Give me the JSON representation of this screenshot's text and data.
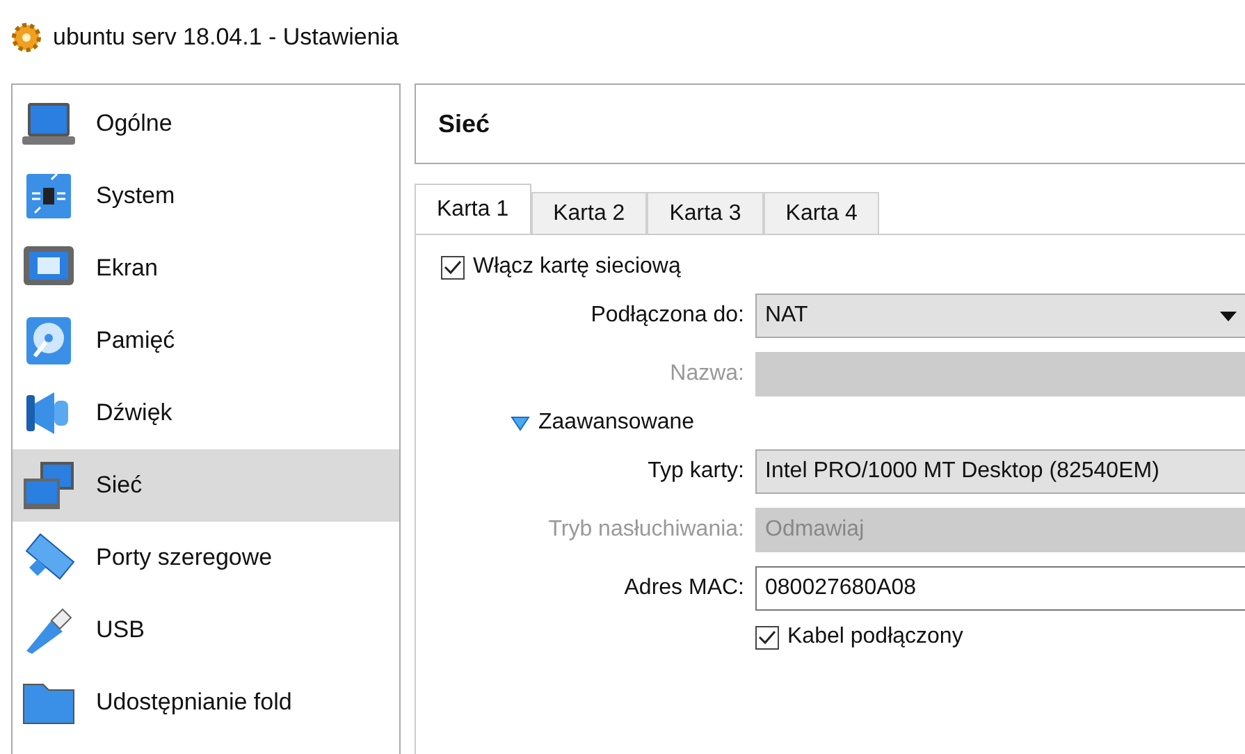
{
  "window": {
    "title": "ubuntu serv 18.04.1 - Ustawienia"
  },
  "sidebar": {
    "items": [
      {
        "label": "Ogólne",
        "selected": false
      },
      {
        "label": "System",
        "selected": false
      },
      {
        "label": "Ekran",
        "selected": false
      },
      {
        "label": "Pamięć",
        "selected": false
      },
      {
        "label": "Dźwięk",
        "selected": false
      },
      {
        "label": "Sieć",
        "selected": true
      },
      {
        "label": "Porty szeregowe",
        "selected": false
      },
      {
        "label": "USB",
        "selected": false
      },
      {
        "label": "Udostępnianie fold",
        "selected": false
      }
    ]
  },
  "page": {
    "title": "Sieć"
  },
  "tabs": [
    {
      "label": "Karta 1",
      "selected": true
    },
    {
      "label": "Karta 2",
      "selected": false
    },
    {
      "label": "Karta 3",
      "selected": false
    },
    {
      "label": "Karta 4",
      "selected": false
    }
  ],
  "enable_adapter": {
    "label": "Włącz kartę sieciową",
    "checked": true
  },
  "fields_top": [
    {
      "kind": "dropdown",
      "label": "Podłączona do:",
      "value": "NAT",
      "disabled": false
    },
    {
      "kind": "field",
      "label": "Nazwa:",
      "disabled": true
    }
  ],
  "advanced": {
    "label": "Zaawansowane",
    "expanded": true
  },
  "fields_advanced": [
    {
      "kind": "field",
      "label": "Typ karty:",
      "value": "Intel PRO/1000 MT Desktop (82540EM)",
      "disabled": false
    },
    {
      "kind": "field",
      "label": "Tryb nasłuchiwania:",
      "value": "Odmawiaj",
      "disabled": true
    },
    {
      "kind": "input",
      "label": "Adres MAC:",
      "value": "080027680A08",
      "disabled": false
    }
  ],
  "cable": {
    "label": "Kabel podłączony",
    "checked": true
  }
}
